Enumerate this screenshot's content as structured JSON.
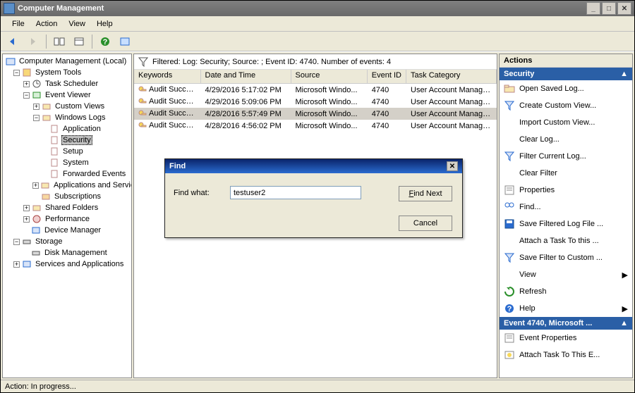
{
  "title": "Computer Management",
  "menu": [
    "File",
    "Action",
    "View",
    "Help"
  ],
  "tree": {
    "root": "Computer Management (Local)",
    "n1": "System Tools",
    "n1a": "Task Scheduler",
    "n1b": "Event Viewer",
    "n1b1": "Custom Views",
    "n1b2": "Windows Logs",
    "n1b2a": "Application",
    "n1b2b": "Security",
    "n1b2c": "Setup",
    "n1b2d": "System",
    "n1b2e": "Forwarded Events",
    "n1b3": "Applications and Services Logs",
    "n1b4": "Subscriptions",
    "n1c": "Shared Folders",
    "n1d": "Performance",
    "n1e": "Device Manager",
    "n2": "Storage",
    "n2a": "Disk Management",
    "n3": "Services and Applications"
  },
  "filter_text": "Filtered: Log: Security; Source: ; Event ID: 4740. Number of events: 4",
  "columns": {
    "kw": "Keywords",
    "dt": "Date and Time",
    "src": "Source",
    "ev": "Event ID",
    "tc": "Task Category"
  },
  "rows": [
    {
      "kw": "Audit Success",
      "dt": "4/29/2016 5:17:02 PM",
      "src": "Microsoft Windo...",
      "ev": "4740",
      "tc": "User Account Managem...",
      "sel": false
    },
    {
      "kw": "Audit Success",
      "dt": "4/29/2016 5:09:06 PM",
      "src": "Microsoft Windo...",
      "ev": "4740",
      "tc": "User Account Managem...",
      "sel": false
    },
    {
      "kw": "Audit Success",
      "dt": "4/28/2016 5:57:49 PM",
      "src": "Microsoft Windo...",
      "ev": "4740",
      "tc": "User Account Managem...",
      "sel": true
    },
    {
      "kw": "Audit Success",
      "dt": "4/28/2016 4:56:02 PM",
      "src": "Microsoft Windo...",
      "ev": "4740",
      "tc": "User Account Managem...",
      "sel": false
    }
  ],
  "actions_header": "Actions",
  "actions_section1": "Security",
  "actions1": [
    {
      "label": "Open Saved Log...",
      "icon": "folder"
    },
    {
      "label": "Create Custom View...",
      "icon": "funnel"
    },
    {
      "label": "Import Custom View...",
      "icon": ""
    },
    {
      "label": "Clear Log...",
      "icon": ""
    },
    {
      "label": "Filter Current Log...",
      "icon": "funnel"
    },
    {
      "label": "Clear Filter",
      "icon": ""
    },
    {
      "label": "Properties",
      "icon": "props"
    },
    {
      "label": "Find...",
      "icon": "find"
    },
    {
      "label": "Save Filtered Log File ...",
      "icon": "save"
    },
    {
      "label": "Attach a Task To this ...",
      "icon": ""
    },
    {
      "label": "Save Filter to Custom ...",
      "icon": "funnel"
    },
    {
      "label": "View",
      "icon": "",
      "arrow": true
    },
    {
      "label": "Refresh",
      "icon": "refresh"
    },
    {
      "label": "Help",
      "icon": "help",
      "arrow": true
    }
  ],
  "actions_section2": "Event 4740, Microsoft ...",
  "actions2": [
    {
      "label": "Event Properties",
      "icon": "props"
    },
    {
      "label": "Attach Task To This E...",
      "icon": "task"
    }
  ],
  "find": {
    "title": "Find",
    "label": "Find what:",
    "value": "testuser2",
    "next": "Find Next",
    "next_u": "F",
    "cancel": "Cancel"
  },
  "status": "Action:  In progress..."
}
